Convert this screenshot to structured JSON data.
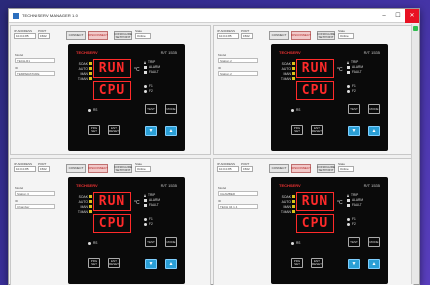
{
  "window": {
    "title": "TECHNISERV MANAGER 1.0",
    "controls": {
      "minimize": "–",
      "maximize": "☐",
      "close": "✕"
    }
  },
  "panels": [
    {
      "f1": "10.0.0.85",
      "f2": "1502",
      "connect": "CONNECT",
      "disconnect": "DISCONNECT",
      "config": "CONFIGURE SETPOINT",
      "state_label": "State",
      "state_val": "Online",
      "side": [
        {
          "label": "Model",
          "val": "TECH-R1"
        },
        {
          "label": "ID",
          "val": "TEMPERATURE"
        }
      ]
    },
    {
      "f1": "10.0.0.85",
      "f2": "1502",
      "connect": "CONNECT",
      "disconnect": "DISCONNECT",
      "config": "CONFIGURE SETPOINT",
      "state_label": "State",
      "state_val": "Online",
      "side": [
        {
          "label": "Model",
          "val": "Station 2"
        },
        {
          "label": "ID",
          "val": "Station 2"
        }
      ]
    },
    {
      "f1": "10.0.0.85",
      "f2": "1502",
      "connect": "CONNECT",
      "disconnect": "DISCONNECT",
      "config": "CONFIGURE SETPOINT",
      "state_label": "State",
      "state_val": "Online",
      "side": [
        {
          "label": "Model",
          "val": "Station 3"
        },
        {
          "label": "ID",
          "val": "Chamber"
        }
      ]
    },
    {
      "f1": "10.0.0.85",
      "f2": "1502",
      "connect": "CONNECT",
      "disconnect": "DISCONNECT",
      "config": "CONFIGURE SETPOINT",
      "state_label": "State",
      "state_val": "Online",
      "side": [
        {
          "label": "Model",
          "val": "CHAMBER"
        },
        {
          "label": "ID",
          "val": "TECH 04 1 4"
        }
      ]
    }
  ],
  "device": {
    "logo": "TECHSERV",
    "model": "R/T 1535",
    "upper": "RUN",
    "lower": "CPU",
    "unit": "°C",
    "left_leds": [
      "SOAK",
      "AUTO",
      "MAN",
      "T.MAN"
    ],
    "right_leds": [
      "TRIP",
      "ALARM",
      "FAULT"
    ],
    "f_leds": [
      "F1",
      "F2"
    ],
    "rs": "RS",
    "keys": {
      "test": "TEST",
      "mode": "MODE",
      "prg": "PRG\nSET",
      "ent": "ENT\nRESET",
      "down": "▼",
      "up": "▲"
    }
  },
  "colors": {
    "display": "#ff2a2a",
    "accent_blue": "#2a9fd6",
    "status_green": "#2fbf4f"
  }
}
